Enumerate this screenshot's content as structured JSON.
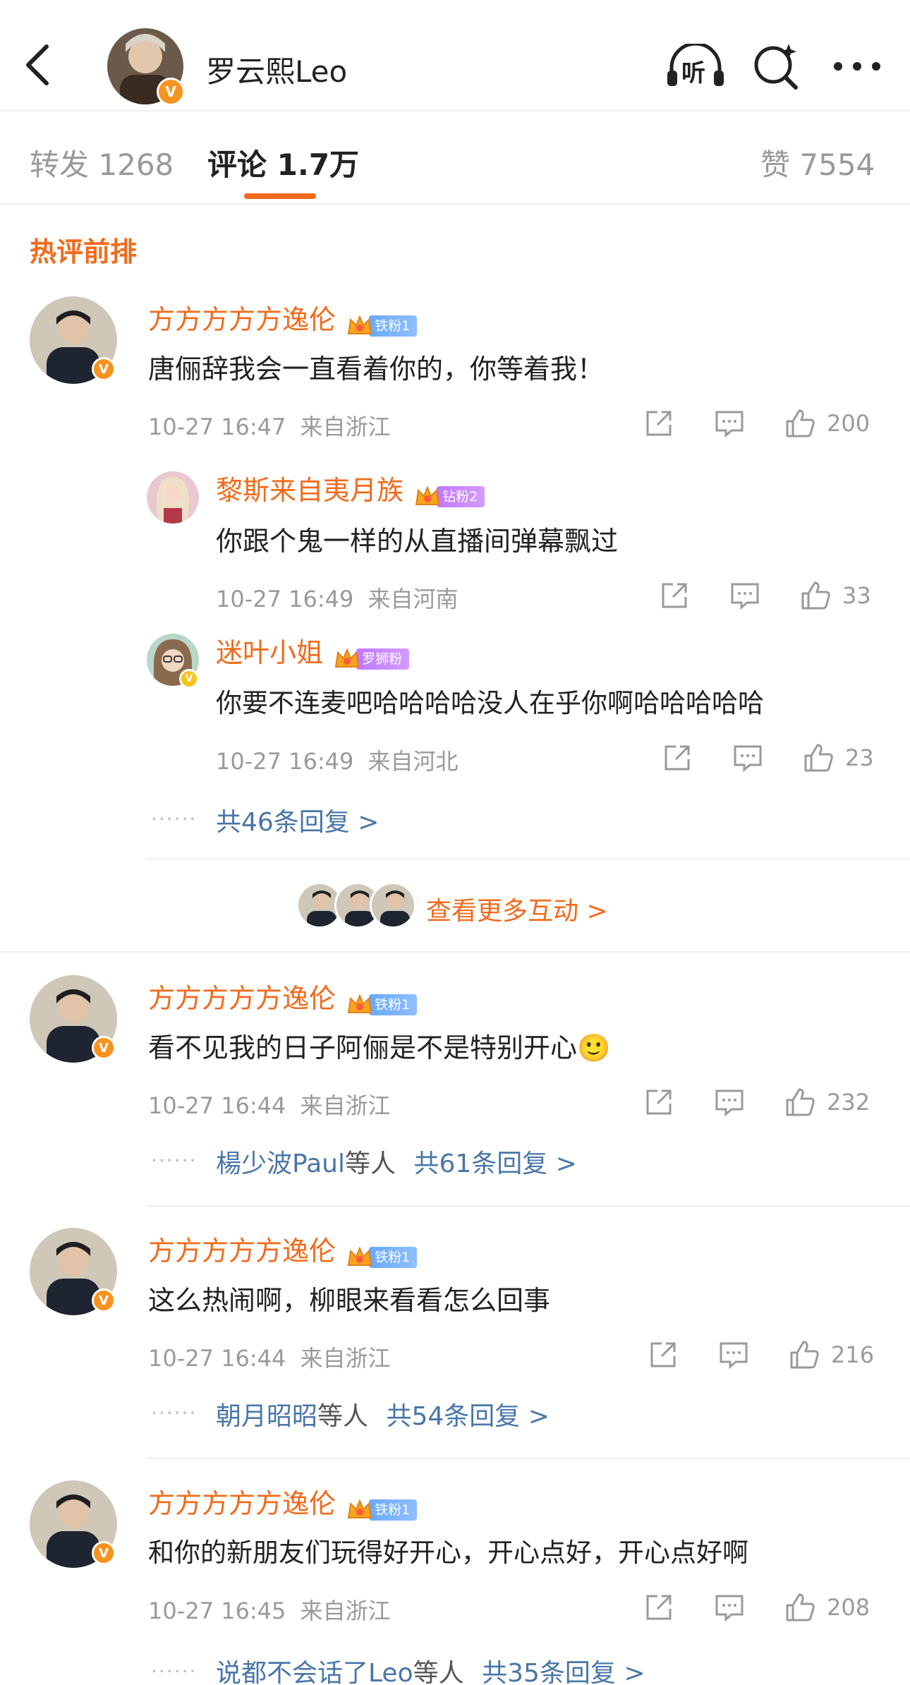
{
  "header": {
    "title": "罗云熙Leo",
    "listen_label": "听"
  },
  "tabs": {
    "repost_label": "转发",
    "repost_count": "1268",
    "comment_label": "评论",
    "comment_count": "1.7万",
    "like_label": "赞",
    "like_count": "7554"
  },
  "section_title": "热评前排",
  "comments": [
    {
      "user": "方方方方方逸伦",
      "badge": "铁粉1",
      "text": "唐俪辞我会一直看着你的，你等着我！",
      "time": "10-27 16:47",
      "location": "来自浙江",
      "likes": "200"
    },
    {
      "user": "方方方方方逸伦",
      "badge": "铁粉1",
      "text": "看不见我的日子阿俪是不是特别开心🙂",
      "time": "10-27 16:44",
      "location": "来自浙江",
      "likes": "232",
      "reply_users": "楊少波Paul",
      "reply_mid": "等人",
      "reply_count": "共61条回复 >"
    },
    {
      "user": "方方方方方逸伦",
      "badge": "铁粉1",
      "text": "这么热闹啊，柳眼来看看怎么回事",
      "time": "10-27 16:44",
      "location": "来自浙江",
      "likes": "216",
      "reply_users": "朝月昭昭",
      "reply_mid": "等人",
      "reply_count": "共54条回复 >"
    },
    {
      "user": "方方方方方逸伦",
      "badge": "铁粉1",
      "text": "和你的新朋友们玩得好开心，开心点好，开心点好啊",
      "time": "10-27 16:45",
      "location": "来自浙江",
      "likes": "208",
      "reply_users": "说都不会话了Leo",
      "reply_mid": "等人",
      "reply_count": "共35条回复 >"
    }
  ],
  "replies": [
    {
      "user": "黎斯来自夷月族",
      "badge": "钻粉2",
      "text": "你跟个鬼一样的从直播间弹幕飘过",
      "time": "10-27 16:49",
      "location": "来自河南",
      "likes": "33"
    },
    {
      "user": "迷叶小姐",
      "badge": "罗狮粉",
      "text": "你要不连麦吧哈哈哈哈没人在乎你啊哈哈哈哈哈",
      "time": "10-27 16:49",
      "location": "来自河北",
      "likes": "23"
    }
  ],
  "thread_more": "共46条回复 >",
  "more_interactions": "查看更多互动 >",
  "colors": {
    "accent": "#f26a1b",
    "link": "#4a76a8",
    "meta": "#9a9a9a"
  }
}
